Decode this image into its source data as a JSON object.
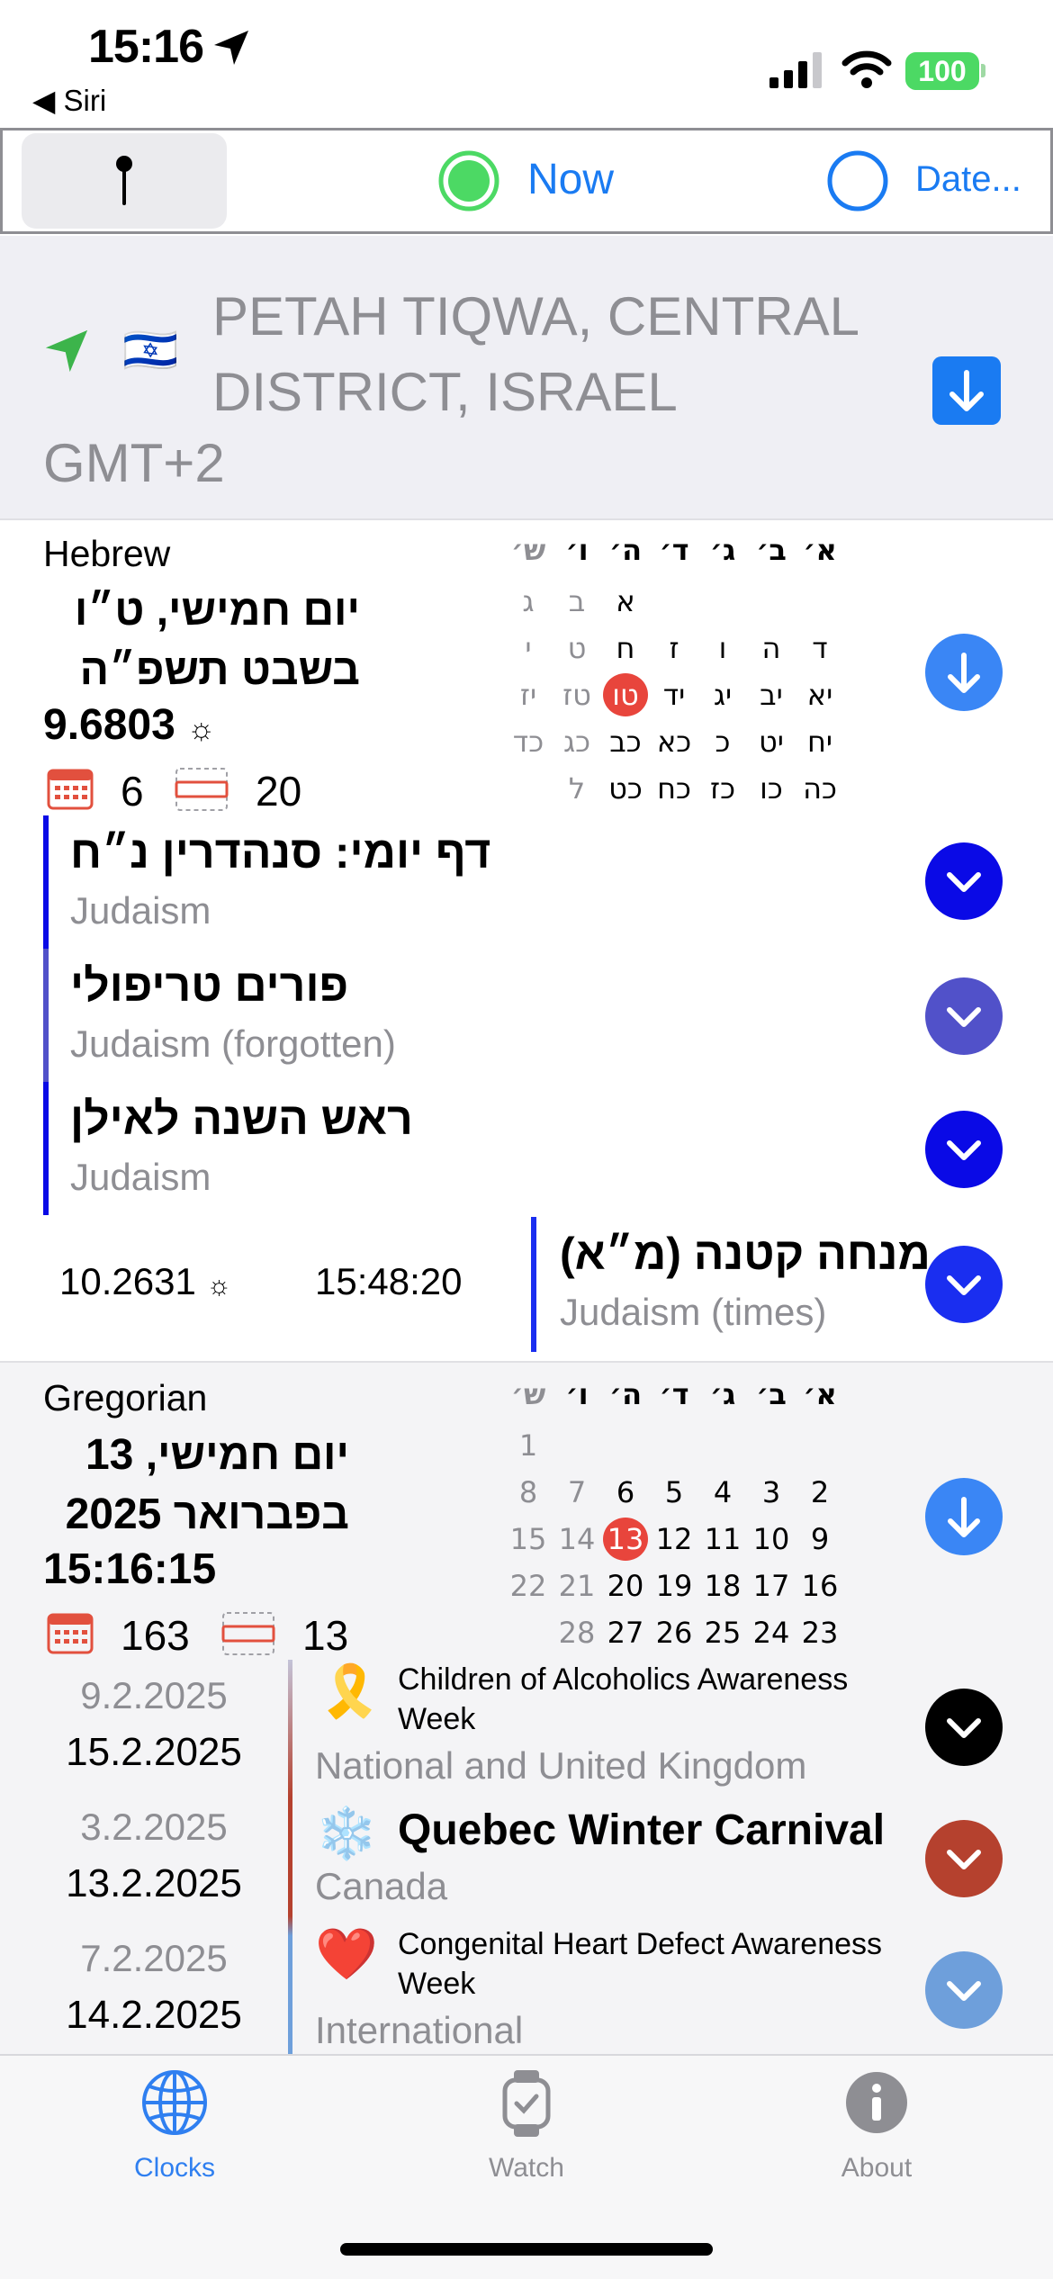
{
  "status": {
    "time": "15:16",
    "back": "◀ Siri",
    "battery": "100"
  },
  "toolbar": {
    "now": "Now",
    "date": "Date..."
  },
  "location": {
    "flag": "🇮🇱",
    "city": "PETAH TIQWA, CENTRAL DISTRICT, ISRAEL",
    "gmt": "GMT+2"
  },
  "hebrew": {
    "label": "Hebrew",
    "line1": "יום חמישי, ט״ו",
    "line2": "בשבט תשפ״ה",
    "value": "9.6803",
    "count1": "6",
    "count2": "20",
    "cal_header": [
      "א׳",
      "ב׳",
      "ג׳",
      "ד׳",
      "ה׳",
      "ו׳",
      "ש׳"
    ],
    "cal_rows": [
      [
        "",
        "",
        "",
        "",
        "א",
        "ב",
        "ג"
      ],
      [
        "ד",
        "ה",
        "ו",
        "ז",
        "ח",
        "ט",
        "י"
      ],
      [
        "יא",
        "יב",
        "יג",
        "יד",
        "טו",
        "טז",
        "יז"
      ],
      [
        "יח",
        "יט",
        "כ",
        "כא",
        "כב",
        "כג",
        "כד"
      ],
      [
        "כה",
        "כו",
        "כז",
        "כח",
        "כט",
        "ל",
        ""
      ]
    ],
    "events": [
      {
        "title": "דף יומי:  סנהדרין נ״ח",
        "sub": "Judaism",
        "color": "#0a0ae6"
      },
      {
        "title": "פורים טריפולי",
        "sub": "Judaism (forgotten)",
        "color": "#5151c9"
      },
      {
        "title": "ראש השנה לאילן",
        "sub": "Judaism",
        "color": "#0a0ae6"
      }
    ],
    "time_value": "10.2631",
    "time_clock": "15:48:20",
    "time_event": {
      "title": "מנחה קטנה (מ״א)",
      "sub": "Judaism (times)",
      "color": "#1a2ef0"
    }
  },
  "gregorian": {
    "label": "Gregorian",
    "line1": "יום חמישי, 13",
    "line2": "בפברואר 2025",
    "clock": "15:16:15",
    "count1": "163",
    "count2": "13",
    "cal_header": [
      "א׳",
      "ב׳",
      "ג׳",
      "ד׳",
      "ה׳",
      "ו׳",
      "ש׳"
    ],
    "cal_rows": [
      [
        "",
        "",
        "",
        "",
        "",
        "",
        "1"
      ],
      [
        "2",
        "3",
        "4",
        "5",
        "6",
        "7",
        "8"
      ],
      [
        "9",
        "10",
        "11",
        "12",
        "13",
        "14",
        "15"
      ],
      [
        "16",
        "17",
        "18",
        "19",
        "20",
        "21",
        "22"
      ],
      [
        "23",
        "24",
        "25",
        "26",
        "27",
        "28",
        ""
      ]
    ],
    "events": [
      {
        "start": "9.2.2025",
        "end": "15.2.2025",
        "emoji": "🎗️",
        "title": "Children of Alcoholics Awareness Week",
        "sub": "National and United Kingdom",
        "color": "#000000"
      },
      {
        "start": "3.2.2025",
        "end": "13.2.2025",
        "emoji": "❄️",
        "title": "Quebec Winter Carnival",
        "sub": "Canada",
        "color": "#b5412e"
      },
      {
        "start": "7.2.2025",
        "end": "14.2.2025",
        "emoji": "❤️",
        "title": "Congenital Heart Defect Awareness Week",
        "sub": "International",
        "color": "#6e9fdb"
      }
    ]
  },
  "tabs": [
    {
      "label": "Clocks",
      "icon": "globe-icon",
      "active": true
    },
    {
      "label": "Watch",
      "icon": "watch-icon",
      "active": false
    },
    {
      "label": "About",
      "icon": "info-icon",
      "active": false
    }
  ],
  "colors": {
    "accent": "#1a7bf2",
    "today": "#e8453c",
    "now_green": "#4cd964"
  }
}
